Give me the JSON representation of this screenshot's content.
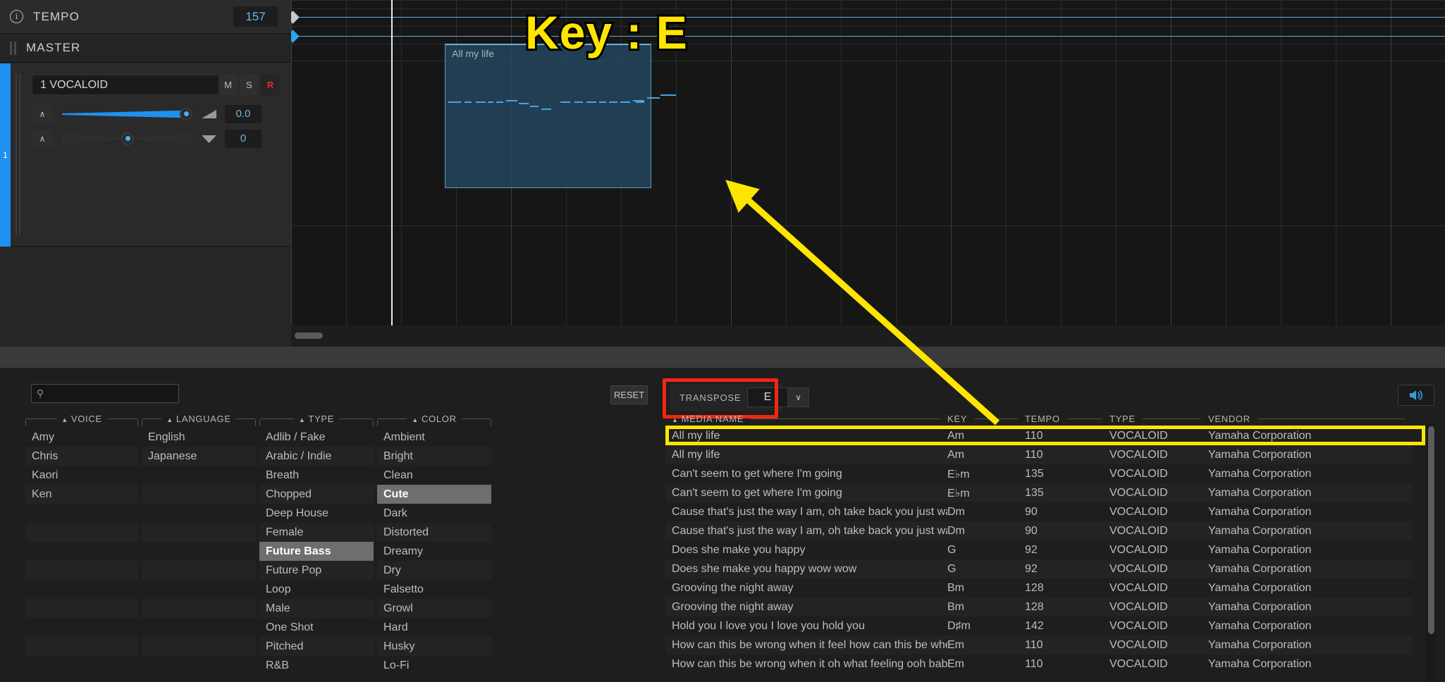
{
  "track_panel": {
    "tempo": {
      "label": "TEMPO",
      "value": "157",
      "icon": "info-icon"
    },
    "master": {
      "label": "MASTER"
    },
    "track": {
      "number": "1",
      "name": "1 VOCALOID",
      "mute": "M",
      "solo": "S",
      "record": "R",
      "volume_value": "0.0",
      "pan_value": "0",
      "caret": "∧"
    }
  },
  "timeline": {
    "clip": {
      "title": "All my life"
    },
    "annotation": {
      "key_text": "Key : E"
    }
  },
  "browser": {
    "search": {
      "placeholder": "",
      "value": "",
      "icon": "search-icon"
    },
    "reset_label": "RESET",
    "audition_icon": "speaker-icon",
    "transpose": {
      "label": "TRANSPOSE",
      "value": "E",
      "arrow": "∨"
    },
    "filters": [
      {
        "title": "VOICE",
        "items": [
          "Amy",
          "Chris",
          "Kaori",
          "Ken",
          "",
          "",
          "",
          "",
          "",
          "",
          "",
          "",
          ""
        ],
        "selected": ""
      },
      {
        "title": "LANGUAGE",
        "items": [
          "English",
          "Japanese",
          "",
          "",
          "",
          "",
          "",
          "",
          "",
          "",
          "",
          "",
          ""
        ],
        "selected": ""
      },
      {
        "title": "TYPE",
        "items": [
          "Adlib / Fake",
          "Arabic / Indie",
          "Breath",
          "Chopped",
          "Deep House",
          "Female",
          "Future Bass",
          "Future Pop",
          "Loop",
          "Male",
          "One Shot",
          "Pitched",
          "R&B"
        ],
        "selected": "Future Bass"
      },
      {
        "title": "COLOR",
        "items": [
          "Ambient",
          "Bright",
          "Clean",
          "Cute",
          "Dark",
          "Distorted",
          "Dreamy",
          "Dry",
          "Falsetto",
          "Growl",
          "Hard",
          "Husky",
          "Lo-Fi"
        ],
        "selected": "Cute"
      }
    ],
    "table": {
      "columns": [
        "MEDIA NAME",
        "KEY",
        "TEMPO",
        "TYPE",
        "VENDOR"
      ],
      "sort_column": "MEDIA NAME",
      "selected_row_index": 0,
      "rows": [
        {
          "name": "All my life",
          "key": "Am",
          "tempo": "110",
          "type": "VOCALOID",
          "vendor": "Yamaha Corporation"
        },
        {
          "name": "All my life",
          "key": "Am",
          "tempo": "110",
          "type": "VOCALOID",
          "vendor": "Yamaha Corporation"
        },
        {
          "name": "Can't seem to get where I'm going",
          "key": "E♭m",
          "tempo": "135",
          "type": "VOCALOID",
          "vendor": "Yamaha Corporation"
        },
        {
          "name": "Can't seem to get where I'm going",
          "key": "E♭m",
          "tempo": "135",
          "type": "VOCALOID",
          "vendor": "Yamaha Corporation"
        },
        {
          "name": "Cause that's just the way I am, oh take back you just wait",
          "key": "Dm",
          "tempo": "90",
          "type": "VOCALOID",
          "vendor": "Yamaha Corporation"
        },
        {
          "name": "Cause that's just the way I am, oh take back you just wait",
          "key": "Dm",
          "tempo": "90",
          "type": "VOCALOID",
          "vendor": "Yamaha Corporation"
        },
        {
          "name": "Does she make you happy",
          "key": "G",
          "tempo": "92",
          "type": "VOCALOID",
          "vendor": "Yamaha Corporation"
        },
        {
          "name": "Does she make you happy wow wow",
          "key": "G",
          "tempo": "92",
          "type": "VOCALOID",
          "vendor": "Yamaha Corporation"
        },
        {
          "name": "Grooving the night away",
          "key": "Bm",
          "tempo": "128",
          "type": "VOCALOID",
          "vendor": "Yamaha Corporation"
        },
        {
          "name": "Grooving the night away",
          "key": "Bm",
          "tempo": "128",
          "type": "VOCALOID",
          "vendor": "Yamaha Corporation"
        },
        {
          "name": "Hold you I love you I love you hold you",
          "key": "D♯m",
          "tempo": "142",
          "type": "VOCALOID",
          "vendor": "Yamaha Corporation"
        },
        {
          "name": "How can this be wrong when it feel how can this be when it feel",
          "key": "Em",
          "tempo": "110",
          "type": "VOCALOID",
          "vendor": "Yamaha Corporation"
        },
        {
          "name": "How can this be wrong when it oh what feeling ooh baby",
          "key": "Em",
          "tempo": "110",
          "type": "VOCALOID",
          "vendor": "Yamaha Corporation"
        }
      ]
    }
  },
  "colors": {
    "accent_blue": "#1f90ef",
    "annotation_yellow": "#ffe600",
    "annotation_red": "#f22613",
    "record_red": "#e8292f"
  }
}
